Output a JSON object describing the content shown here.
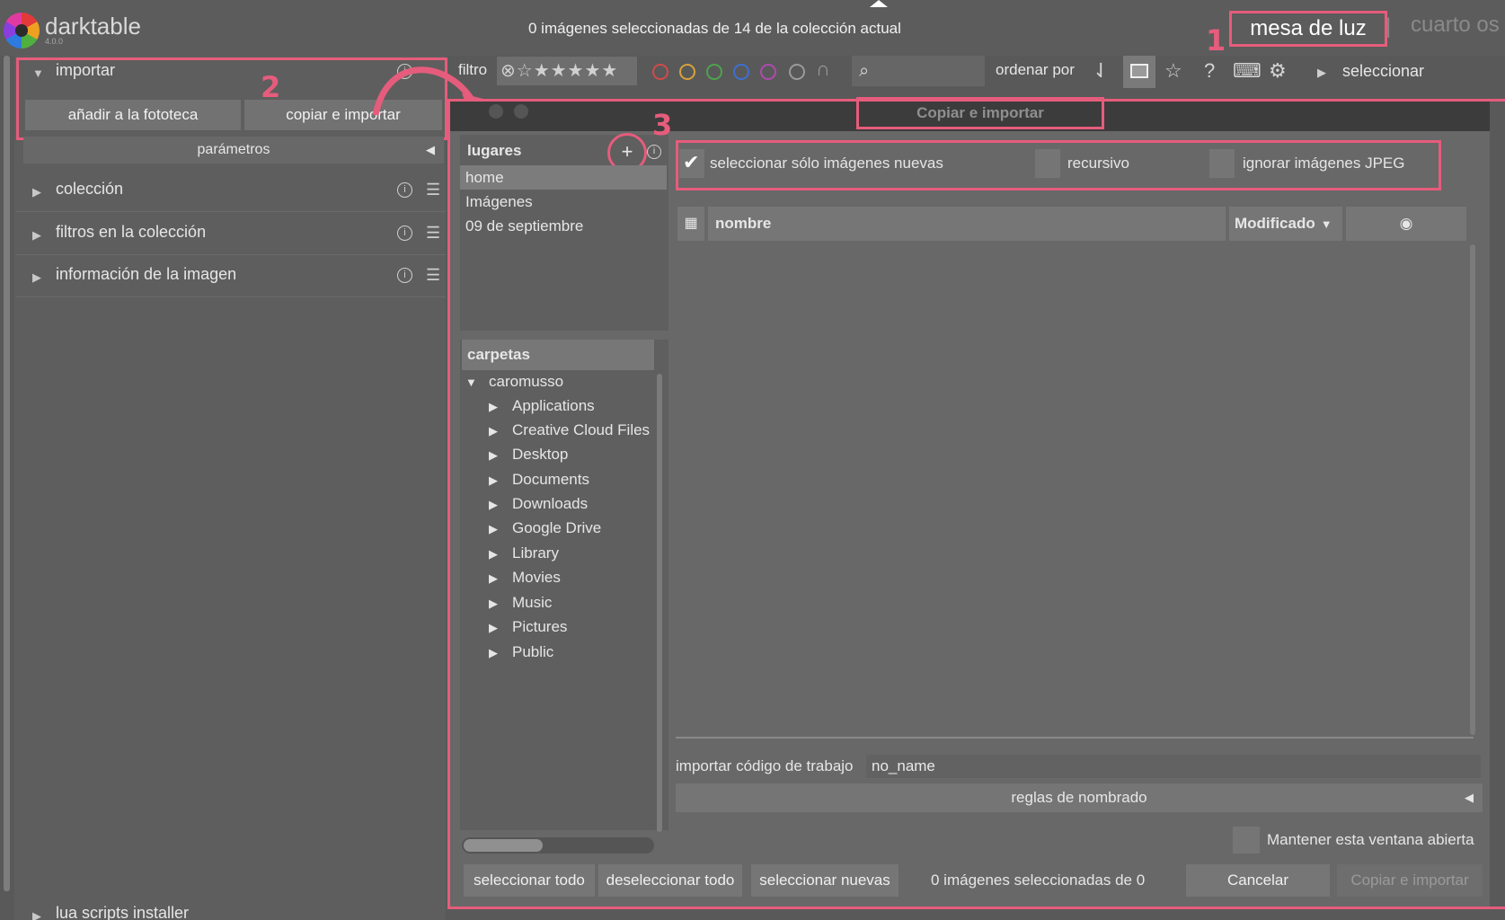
{
  "app": {
    "name": "darktable",
    "version": "4.0.0",
    "status": "0 imágenes seleccionadas de 14 de la colección actual",
    "views": {
      "active": "mesa de luz",
      "separator": "|",
      "other": "cuarto os"
    }
  },
  "annotations": {
    "one": "1",
    "two": "2",
    "three": "3"
  },
  "left_panel": {
    "import_module": {
      "label": "importar",
      "add_button": "añadir a la fototeca",
      "copy_button": "copiar e importar",
      "params": "parámetros"
    },
    "modules": [
      "colección",
      "filtros en la colección",
      "información de la imagen",
      "lua scripts installer"
    ]
  },
  "filter_bar": {
    "filter_label": "filtro",
    "stars": "⊗☆★★★★★",
    "color_labels": [
      "#d24a4a",
      "#d6a23a",
      "#4da34d",
      "#3f6fd0",
      "#b04ab0",
      "#9a9a9a"
    ],
    "sort_label": "ordenar por",
    "select_label": "seleccionar"
  },
  "dialog": {
    "title": "Copiar e importar",
    "places_header": "lugares",
    "places": [
      "home",
      "Imágenes",
      "09 de septiembre"
    ],
    "folders_header": "carpetas",
    "root_folder": "caromusso",
    "folders": [
      "Applications",
      "Creative Cloud Files",
      "Desktop",
      "Documents",
      "Downloads",
      "Google Drive",
      "Library",
      "Movies",
      "Music",
      "Pictures",
      "Public"
    ],
    "options": {
      "only_new": "seleccionar sólo imágenes nuevas",
      "recursive": "recursivo",
      "ignore_jpeg": "ignorar imágenes JPEG"
    },
    "list_columns": {
      "name": "nombre",
      "modified": "Modificado"
    },
    "jobcode_label": "importar código de trabajo",
    "jobcode_value": "no_name",
    "naming_rules": "reglas de nombrado",
    "keep_open": "Mantener esta ventana abierta",
    "buttons": {
      "select_all": "seleccionar todo",
      "deselect_all": "deseleccionar todo",
      "select_new": "seleccionar nuevas",
      "cancel": "Cancelar",
      "copy_import": "Copiar e importar"
    },
    "selection_count": "0 imágenes seleccionadas de 0"
  }
}
